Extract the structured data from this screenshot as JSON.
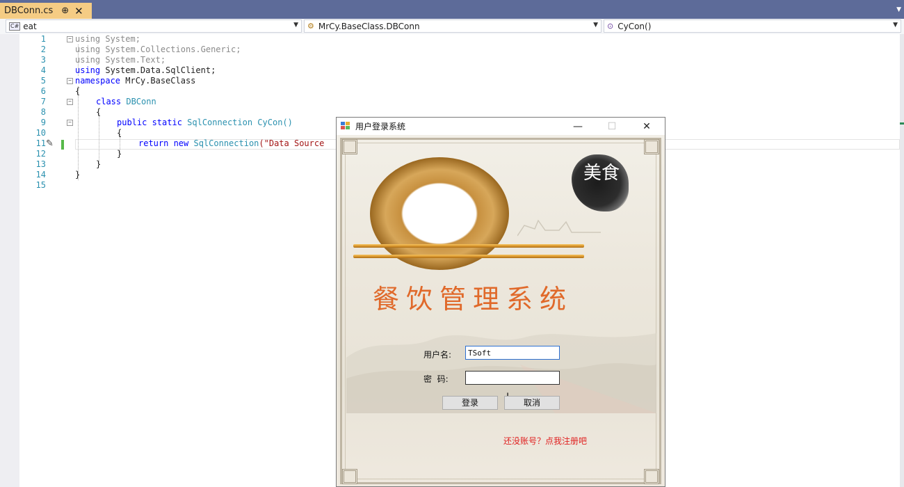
{
  "tab": {
    "filename": "DBConn.cs",
    "pin_glyph": "⊕",
    "close_glyph": "✕"
  },
  "nav": {
    "project": "eat",
    "class": "MrCy.BaseClass.DBConn",
    "member": "CyCon()"
  },
  "code": {
    "line_numbers": [
      "1",
      "2",
      "3",
      "4",
      "5",
      "6",
      "7",
      "8",
      "9",
      "10",
      "11",
      "12",
      "13",
      "14",
      "15"
    ],
    "l1_kw": "using",
    "l1_rest": " System;",
    "l2_kw": "using",
    "l2_rest": " System.Collections.Generic;",
    "l3_kw": "using",
    "l3_rest": " System.Text;",
    "l4_kw": "using",
    "l4_rest": " System.Data.SqlClient;",
    "l5_kw": "namespace",
    "l5_rest": " MrCy.BaseClass",
    "l6": "{",
    "l7_kw": "class",
    "l7_type": " DBConn",
    "l8": "{",
    "l9_kw": "public static",
    "l9_type": " SqlConnection",
    "l9_name": " CyCon()",
    "l10": "{",
    "l11_kw": "return new",
    "l11_type": " SqlConnection",
    "l11_str": "(\"Data Source",
    "l12": "}",
    "l13": "}",
    "l14": "}"
  },
  "dialog": {
    "title": "用户登录系统",
    "minimize": "—",
    "maximize": "☐",
    "close": "✕",
    "banner_title": "餐饮管理系统",
    "seal_text": "美食",
    "username_label": "用户名:",
    "username_value": "TSoft",
    "password_label": "密  码:",
    "password_value": "",
    "login_button": "登录",
    "cancel_button": "取消",
    "register_link": "还没账号？点我注册吧"
  },
  "colors": {
    "accent_title": "#e0692a",
    "link": "#e02020",
    "tab_active": "#f5cc84",
    "tabstrip": "#5d6b99"
  }
}
